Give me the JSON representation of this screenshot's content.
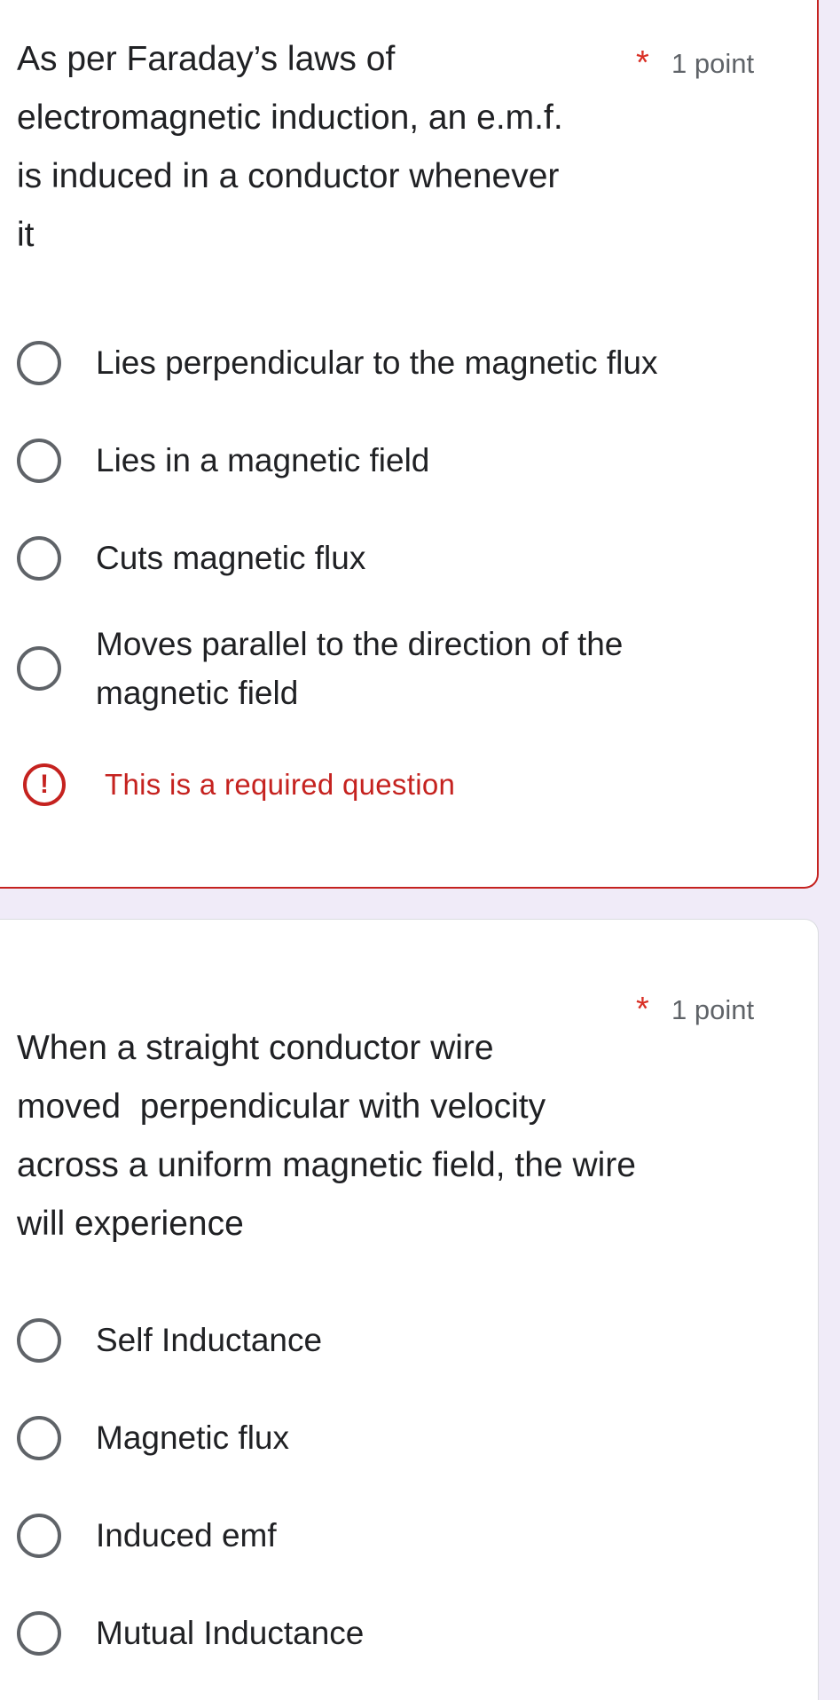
{
  "questions": [
    {
      "text": "As per Faraday’s laws of electromagnetic induction, an e.m.f. is induced in a conductor whenever it",
      "required_mark": "*",
      "points": "1 point",
      "options": [
        "Lies perpendicular to the magnetic flux",
        "Lies in a magnetic field",
        "Cuts magnetic flux",
        "Moves parallel to the direction of the magnetic field"
      ],
      "error": {
        "icon": "!",
        "text": "This is a required question"
      }
    },
    {
      "text": "When a straight conductor wire moved  perpendicular with velocity across a uniform magnetic field, the wire will experience",
      "required_mark": "*",
      "points": "1 point",
      "options": [
        "Self Inductance",
        "Magnetic flux",
        "Induced emf",
        "Mutual Inductance"
      ]
    }
  ],
  "colors": {
    "background": "#f0ebf8",
    "card": "#ffffff",
    "error": "#c5221f",
    "required": "#d93025",
    "text": "#202124",
    "secondary_text": "#5f6368"
  },
  "icons": {
    "radio": "radio-unchecked-icon",
    "error": "error-alert-icon"
  }
}
